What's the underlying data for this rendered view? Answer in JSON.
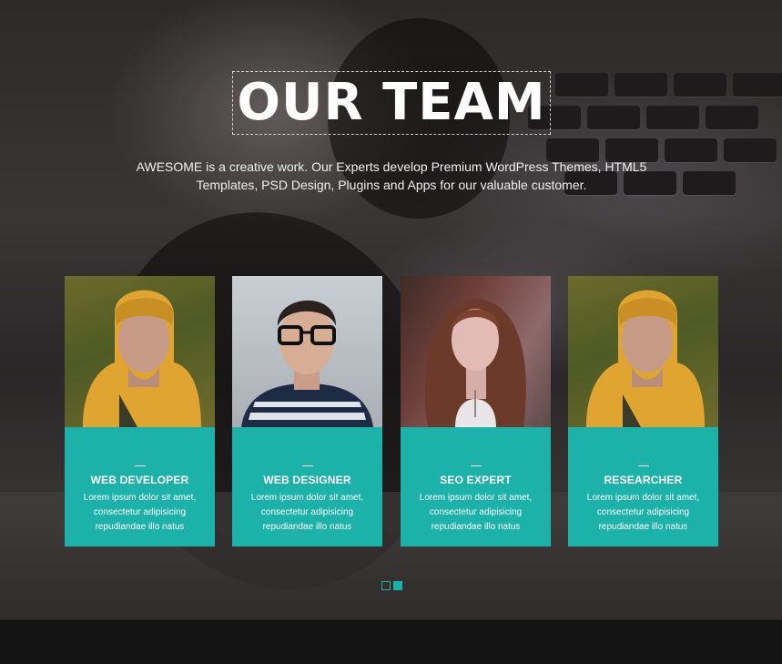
{
  "section": {
    "title": "OUR TEAM",
    "intro": "AWESOME is a creative work. Our Experts develop Premium WordPress Themes, HTML5 Templates, PSD Design, Plugins and Apps for our valuable customer."
  },
  "team": [
    {
      "role": "WEB DEVELOPER",
      "description": "Lorem ipsum dolor sit amet, consectetur adipisicing repudiandae illo natus"
    },
    {
      "role": "WEB DESIGNER",
      "description": "Lorem ipsum dolor sit amet, consectetur adipisicing repudiandae illo natus"
    },
    {
      "role": "SEO EXPERT",
      "description": "Lorem ipsum dolor sit amet, consectetur adipisicing repudiandae illo natus"
    },
    {
      "role": "RESEARCHER",
      "description": "Lorem ipsum dolor sit amet, consectetur adipisicing repudiandae illo natus"
    }
  ],
  "pagination": {
    "pages": 2,
    "active_page": 2
  },
  "colors": {
    "accent": "#1db2a9",
    "title": "#ffffff"
  }
}
